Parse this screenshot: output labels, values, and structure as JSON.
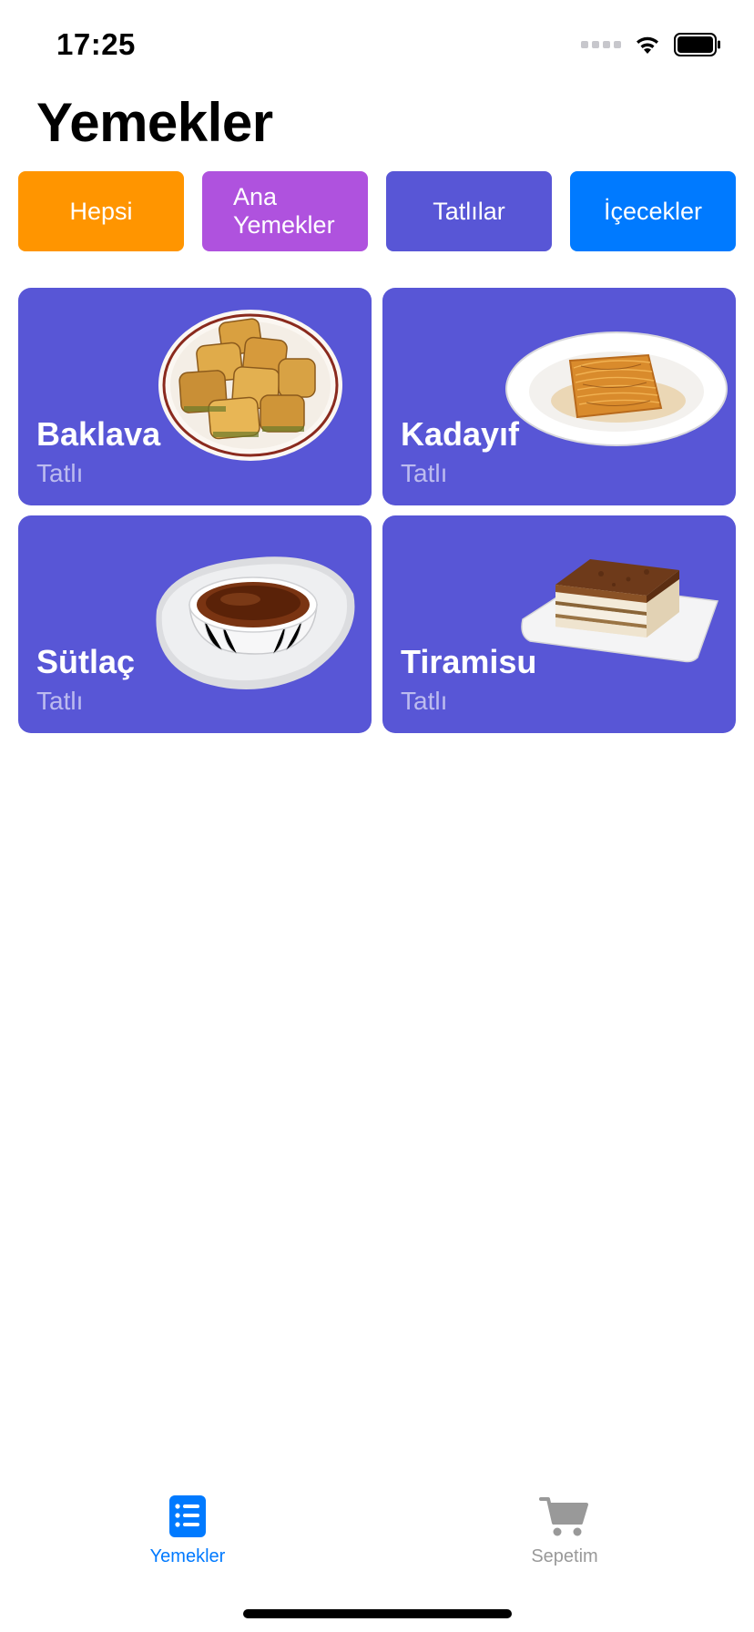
{
  "status": {
    "time": "17:25"
  },
  "title": "Yemekler",
  "categories": [
    {
      "label": "Hepsi",
      "color": "#ff9500"
    },
    {
      "label": "Ana\nYemekler",
      "color": "#af52de"
    },
    {
      "label": "Tatlılar",
      "color": "#5856d6"
    },
    {
      "label": "İçecekler",
      "color": "#007aff"
    }
  ],
  "cards": [
    {
      "name": "Baklava",
      "category": "Tatlı",
      "image": "baklava-plate"
    },
    {
      "name": "Kadayıf",
      "category": "Tatlı",
      "image": "kadayif-plate"
    },
    {
      "name": "Sütlaç",
      "category": "Tatlı",
      "image": "sutlac-bowl"
    },
    {
      "name": "Tiramisu",
      "category": "Tatlı",
      "image": "tiramisu-plate"
    }
  ],
  "tabbar": {
    "tabs": [
      {
        "label": "Yemekler",
        "icon": "list-icon",
        "active": true,
        "color": "#007aff"
      },
      {
        "label": "Sepetim",
        "icon": "cart-icon",
        "active": false,
        "color": "#999999"
      }
    ]
  },
  "colors": {
    "card_bg": "#5856d6",
    "accent": "#007aff"
  }
}
